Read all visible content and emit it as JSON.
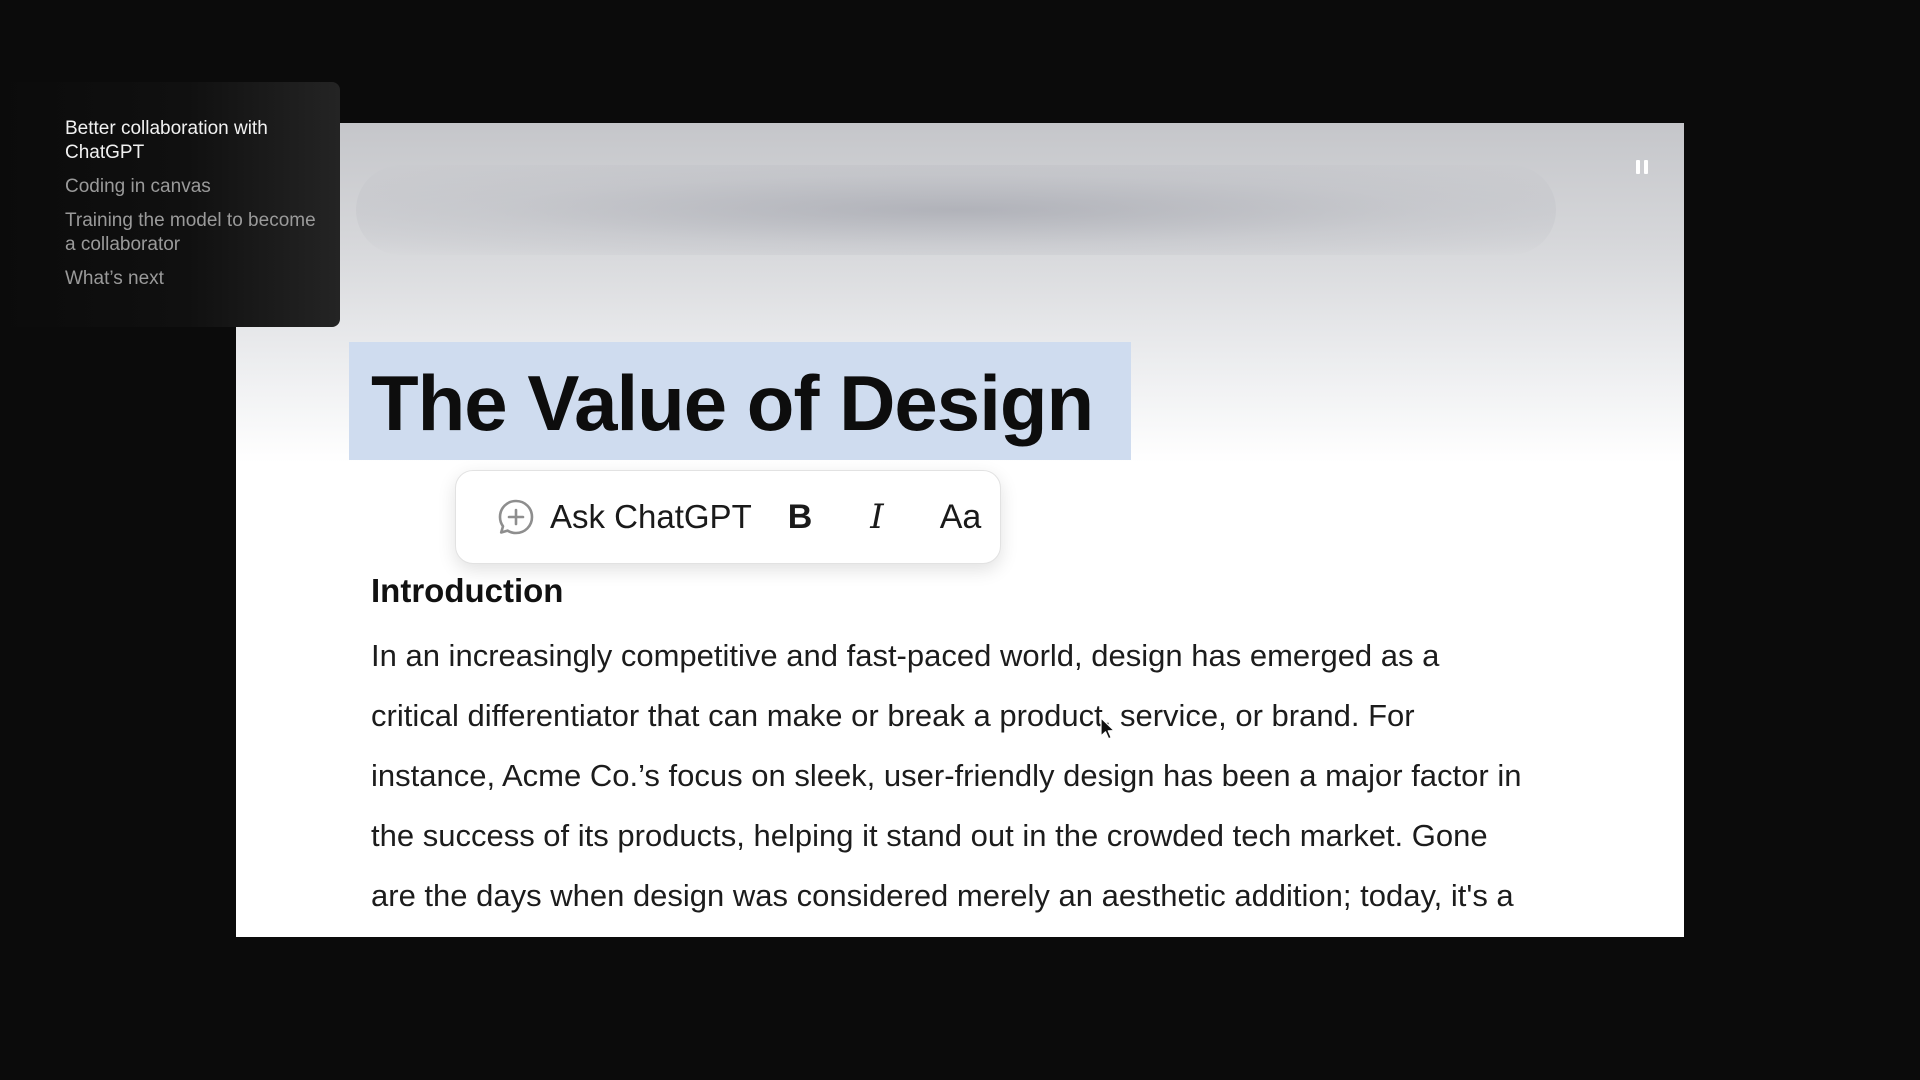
{
  "nav": {
    "items": [
      {
        "label": "Better collaboration with ChatGPT",
        "active": true
      },
      {
        "label": "Coding in canvas",
        "active": false
      },
      {
        "label": "Training the model to become a collaborator",
        "active": false
      },
      {
        "label": "What’s next",
        "active": false
      }
    ]
  },
  "video": {
    "pause_icon": "pause-icon"
  },
  "document": {
    "title": "The Value of Design",
    "section_heading": "Introduction",
    "paragraph_lines": [
      "In an increasingly competitive and fast-paced world, design has emerged as a",
      "critical differentiator that can make or break a product, service, or brand. For",
      "instance, Acme Co.’s focus on sleek, user-friendly design has been a major factor in",
      "the success of its products, helping it stand out in the crowded tech market. Gone",
      "are the days when design was considered merely an aesthetic addition; today, it's a"
    ]
  },
  "toolbar": {
    "ask_label": "Ask ChatGPT",
    "ask_icon": "chat-plus-icon",
    "bold_label": "B",
    "italic_label": "I",
    "font_label": "Aa"
  },
  "colors": {
    "page_background": "#0b0b0b",
    "selection_highlight": "#cfdcef",
    "nav_active": "#f1f1f1",
    "nav_inactive": "#9a9a9a"
  }
}
